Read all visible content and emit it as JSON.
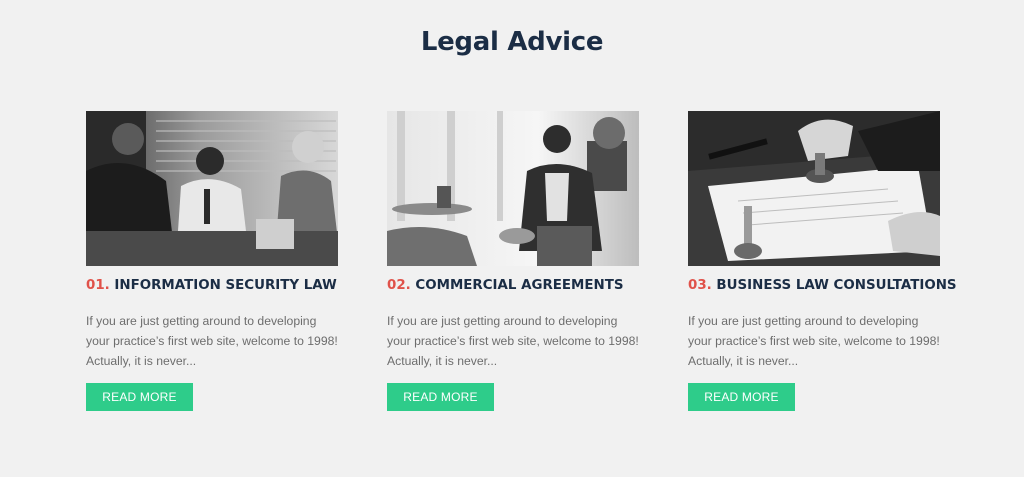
{
  "section": {
    "title": "Legal Advice"
  },
  "cards": [
    {
      "number": "01.",
      "title": "INFORMATION SECURITY LAW",
      "description": "If you are just getting around to developing your practice’s first web site, welcome to 1998! Actually, it is never...",
      "button_label": "READ MORE",
      "image": "black-and-white photo of a business meeting"
    },
    {
      "number": "02.",
      "title": "COMMERCIAL AGREEMENTS",
      "description": "If you are just getting around to developing your practice’s first web site, welcome to 1998! Actually, it is never...",
      "button_label": "READ MORE",
      "image": "black-and-white photo of a woman gesturing in an office"
    },
    {
      "number": "03.",
      "title": "BUSINESS LAW CONSULTATIONS",
      "description": "If you are just getting around to developing your practice’s first web site, welcome to 1998! Actually, it is never...",
      "button_label": "READ MORE",
      "image": "black-and-white photo of a stamp on a document"
    }
  ],
  "colors": {
    "background": "#f1f1f1",
    "heading": "#1b2d45",
    "number_accent": "#e0524a",
    "button": "#2ecc8a",
    "body_text": "#6d6d6d"
  }
}
